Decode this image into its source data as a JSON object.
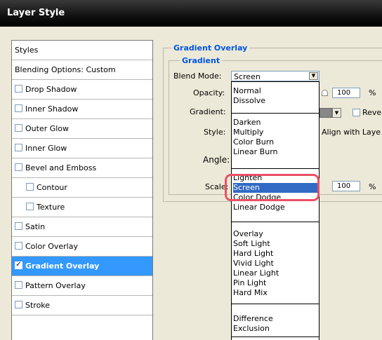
{
  "window": {
    "title": "Layer Style"
  },
  "sidebar": {
    "header": "Styles",
    "items": [
      {
        "label": "Blending Options: Custom",
        "checkbox": false,
        "checked": false,
        "indent": false,
        "selected": false
      },
      {
        "label": "Drop Shadow",
        "checkbox": true,
        "checked": false,
        "indent": false,
        "selected": false
      },
      {
        "label": "Inner Shadow",
        "checkbox": true,
        "checked": false,
        "indent": false,
        "selected": false
      },
      {
        "label": "Outer Glow",
        "checkbox": true,
        "checked": false,
        "indent": false,
        "selected": false
      },
      {
        "label": "Inner Glow",
        "checkbox": true,
        "checked": false,
        "indent": false,
        "selected": false
      },
      {
        "label": "Bevel and Emboss",
        "checkbox": true,
        "checked": false,
        "indent": false,
        "selected": false
      },
      {
        "label": "Contour",
        "checkbox": true,
        "checked": false,
        "indent": true,
        "selected": false
      },
      {
        "label": "Texture",
        "checkbox": true,
        "checked": false,
        "indent": true,
        "selected": false
      },
      {
        "label": "Satin",
        "checkbox": true,
        "checked": false,
        "indent": false,
        "selected": false
      },
      {
        "label": "Color Overlay",
        "checkbox": true,
        "checked": false,
        "indent": false,
        "selected": false
      },
      {
        "label": "Gradient Overlay",
        "checkbox": true,
        "checked": true,
        "indent": false,
        "selected": true
      },
      {
        "label": "Pattern Overlay",
        "checkbox": true,
        "checked": false,
        "indent": false,
        "selected": false
      },
      {
        "label": "Stroke",
        "checkbox": true,
        "checked": false,
        "indent": false,
        "selected": false
      }
    ]
  },
  "panel": {
    "group_title": "Gradient Overlay",
    "sub_title": "Gradient",
    "blend_mode_label": "Blend Mode:",
    "blend_mode_value": "Screen",
    "opacity_label": "Opacity:",
    "opacity_value": "100",
    "opacity_unit": "%",
    "gradient_label": "Gradient:",
    "reverse_label": "Reve",
    "style_label": "Style:",
    "align_label": "Align with Laye",
    "angle_label": "Angle:",
    "scale_label": "Scale:",
    "scale_value": "100",
    "scale_unit": "%"
  },
  "dropdown": {
    "groups": [
      [
        "Normal",
        "Dissolve"
      ],
      [
        "Darken",
        "Multiply",
        "Color Burn",
        "Linear Burn"
      ],
      [
        "Lighten",
        "Screen",
        "Color Dodge",
        "Linear Dodge"
      ],
      [
        "Overlay",
        "Soft Light",
        "Hard Light",
        "Vivid Light",
        "Linear Light",
        "Pin Light",
        "Hard Mix"
      ],
      [
        "Difference",
        "Exclusion"
      ]
    ],
    "selected": "Screen"
  },
  "colors": {
    "selection": "#3399ff",
    "dropdown_selection": "#316ac5",
    "highlight_ring": "#ea5064",
    "legend": "#0054e3"
  }
}
